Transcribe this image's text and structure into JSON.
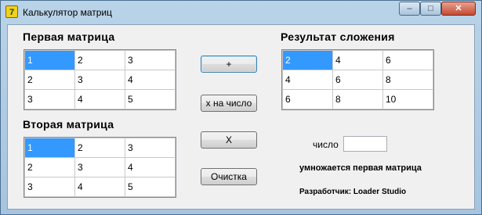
{
  "window": {
    "title": "Калькулятор матриц",
    "icon_glyph": "7",
    "controls": {
      "minimize": "‒",
      "maximize": "□",
      "close": "✕"
    }
  },
  "matrix1": {
    "title": "Первая матрица",
    "rows": [
      [
        "1",
        "2",
        "3"
      ],
      [
        "2",
        "3",
        "4"
      ],
      [
        "3",
        "4",
        "5"
      ]
    ]
  },
  "matrix2": {
    "title": "Вторая матрица",
    "rows": [
      [
        "1",
        "2",
        "3"
      ],
      [
        "2",
        "3",
        "4"
      ],
      [
        "3",
        "4",
        "5"
      ]
    ]
  },
  "result": {
    "title": "Результат сложения",
    "rows": [
      [
        "2",
        "4",
        "6"
      ],
      [
        "4",
        "6",
        "8"
      ],
      [
        "6",
        "8",
        "10"
      ]
    ]
  },
  "buttons": {
    "add": "+",
    "scalar": "х на число",
    "multiply": "Х",
    "clear": "Очистка"
  },
  "number": {
    "label": "число",
    "value": ""
  },
  "notes": {
    "multiply_note": "умножается первая матрица",
    "developer": "Разработчик: Loader Studio"
  }
}
